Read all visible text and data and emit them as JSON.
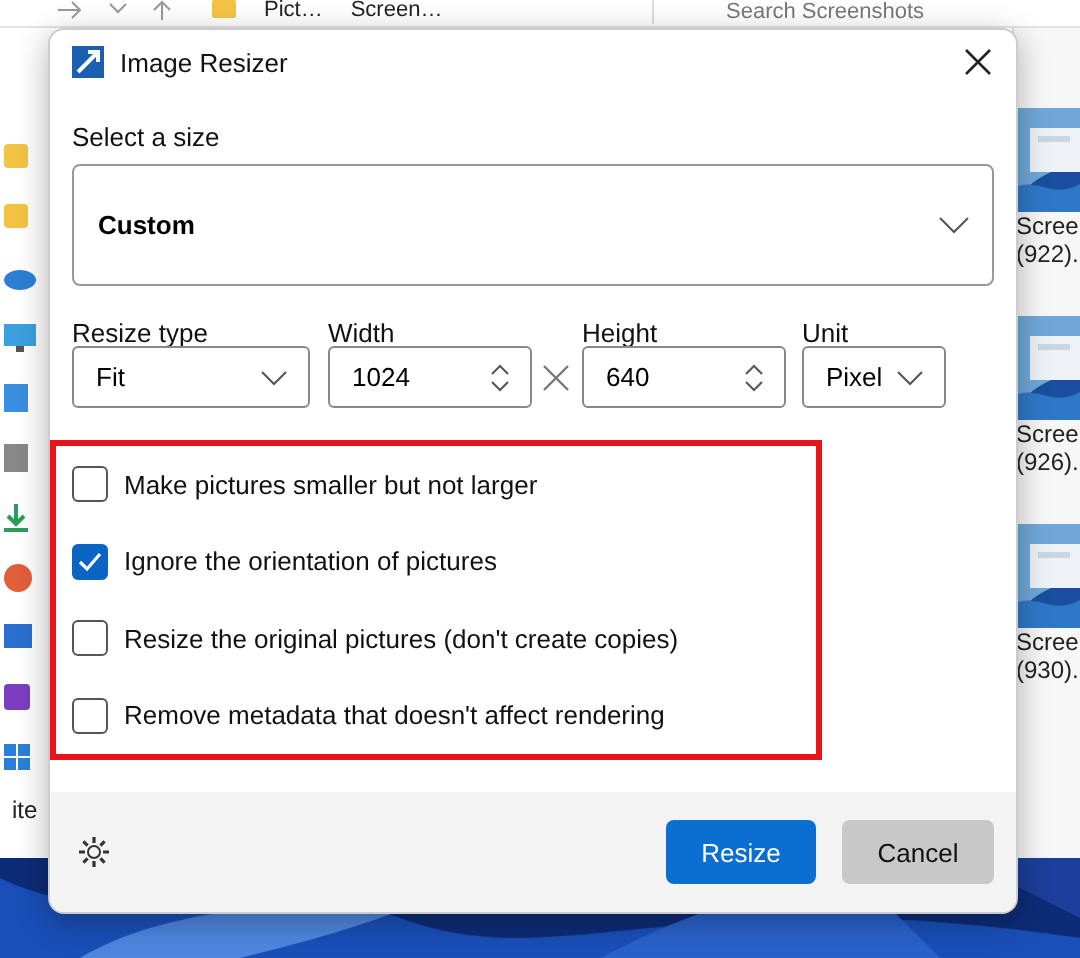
{
  "explorer": {
    "address": [
      "Pict…",
      "Screen…"
    ],
    "search": {
      "placeholder": "Search Screenshots"
    },
    "thumbnails": [
      {
        "name": "Scree",
        "number": "(922)."
      },
      {
        "name": "Scree",
        "number": "(926)."
      },
      {
        "name": "Scree",
        "number": "(930)."
      }
    ],
    "status_bar": "ite"
  },
  "dialog": {
    "title": "Image Resizer",
    "size_label": "Select a size",
    "size": {
      "value": "Custom"
    },
    "fields": [
      {
        "kind": "dropdown",
        "label": "Resize type",
        "value": "Fit"
      },
      {
        "kind": "spinner",
        "label": "Width",
        "value": "1024"
      },
      {
        "kind": "spinner",
        "label": "Height",
        "value": "640"
      },
      {
        "kind": "dropdown",
        "label": "Unit",
        "value": "Pixel"
      }
    ],
    "options": [
      {
        "label": "Make pictures smaller but not larger",
        "checked": false
      },
      {
        "label": "Ignore the orientation of pictures",
        "checked": true
      },
      {
        "label": "Resize the original pictures (don't create copies)",
        "checked": false
      },
      {
        "label": "Remove metadata that doesn't affect rendering",
        "checked": false
      }
    ],
    "buttons": [
      {
        "kind": "primary",
        "label": "Resize"
      },
      {
        "kind": "secondary",
        "label": "Cancel"
      }
    ]
  }
}
